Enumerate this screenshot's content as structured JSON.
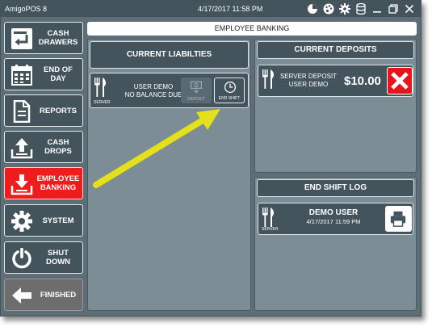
{
  "window": {
    "title": "AmigoPOS 8",
    "datetime": "4/17/2017 11:58 PM"
  },
  "nav": [
    {
      "label": "CASH\nDRAWERS",
      "icon": "cash-drawer-icon"
    },
    {
      "label": "END OF\nDAY",
      "icon": "calendar-icon"
    },
    {
      "label": "REPORTS",
      "icon": "report-icon"
    },
    {
      "label": "CASH\nDROPS",
      "icon": "upload-icon"
    },
    {
      "label": "EMPLOYEE\nBANKING",
      "icon": "download-icon"
    },
    {
      "label": "SYSTEM",
      "icon": "gear-icon"
    },
    {
      "label": "SHUT\nDOWN",
      "icon": "power-icon"
    },
    {
      "label": "FINISHED",
      "icon": "arrow-left-icon"
    }
  ],
  "header": {
    "title": "EMPLOYEE BANKING"
  },
  "liabilities": {
    "title": "CURRENT LIABILTIES",
    "card": {
      "role": "SERVER",
      "name": "USER DEMO",
      "status": "NO BALANCE DUE",
      "deposit_label": "DEPOSIT",
      "end_shift_label": "END SHIFT"
    }
  },
  "deposits": {
    "title": "CURRENT DEPOSITS",
    "card": {
      "line1": "SERVER DEPOSIT",
      "line2": "USER DEMO",
      "amount": "$10.00"
    }
  },
  "shift_log": {
    "title": "END SHIFT LOG",
    "card": {
      "role": "SERVER",
      "name": "DEMO USER",
      "datetime": "4/17/2017 11:59 PM"
    }
  },
  "colors": {
    "accent_red": "#ee1c1c",
    "panel_dark": "#44545c",
    "arrow_yellow": "#f2ef1a"
  }
}
